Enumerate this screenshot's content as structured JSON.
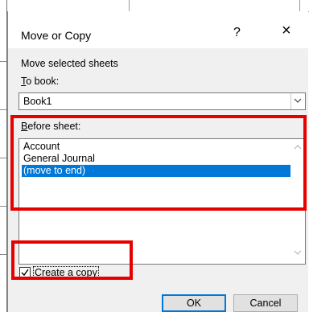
{
  "dialog": {
    "title": "Move or Copy",
    "help_label": "?",
    "close_label": "×"
  },
  "section": {
    "heading": "Move selected sheets",
    "to_book_label": "To book:",
    "before_sheet_label": "Before sheet:"
  },
  "to_book": {
    "value": "Book1"
  },
  "before_sheet": {
    "items": [
      {
        "label": "Account",
        "selected": false
      },
      {
        "label": "General Journal",
        "selected": false
      },
      {
        "label": "(move to end)",
        "selected": true
      }
    ]
  },
  "create_copy": {
    "label": "Create a copy",
    "checked": true
  },
  "buttons": {
    "ok": "OK",
    "cancel": "Cancel"
  },
  "colors": {
    "highlight": "#e60000",
    "selection": "#0078d7"
  }
}
